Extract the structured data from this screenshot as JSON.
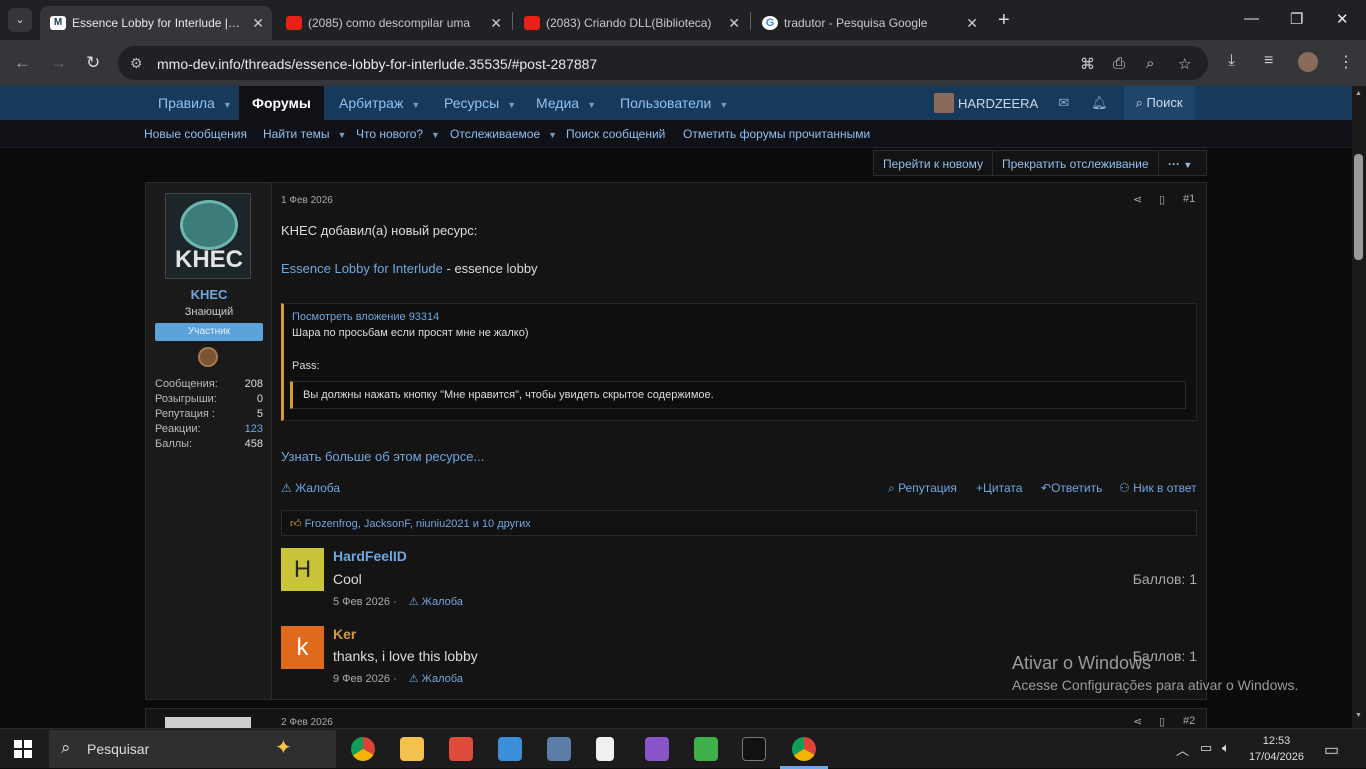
{
  "browser": {
    "tabs": [
      {
        "title": "Essence Lobby for Interlude | Ar",
        "icon": "mmo-dev-icon",
        "active": true
      },
      {
        "title": "(2085) como descompilar uma",
        "icon": "youtube-icon"
      },
      {
        "title": "(2083) Criando DLL(Biblioteca)",
        "icon": "youtube-icon"
      },
      {
        "title": "tradutor - Pesquisa Google",
        "icon": "google-icon"
      }
    ],
    "url": "mmo-dev.info/threads/essence-lobby-for-interlude.35535/#post-287887"
  },
  "forum_nav": {
    "items": [
      "Правила",
      "Форумы",
      "Арбитраж",
      "Ресурсы",
      "Медиа",
      "Пользователи"
    ],
    "active": "Форумы",
    "username": "HARDZEERA",
    "search": "Поиск"
  },
  "sub_nav": [
    "Новые сообщения",
    "Найти темы",
    "Что нового?",
    "Отслеживаемое",
    "Поиск сообщений",
    "Отметить форумы прочитанными"
  ],
  "thread_buttons": {
    "goto_new": "Перейти к новому",
    "unwatch": "Прекратить отслеживание",
    "more": "···"
  },
  "post": {
    "author": {
      "name": "KHEC",
      "avatar_text": "KHEC",
      "title": "Знающий",
      "badge": "Участник",
      "stats": [
        {
          "label": "Сообщения:",
          "value": "208"
        },
        {
          "label": "Розыгрыши:",
          "value": "0"
        },
        {
          "label": "Репутация :",
          "value": "5"
        },
        {
          "label": "Реакции:",
          "value": "123"
        },
        {
          "label": "Баллы:",
          "value": "458"
        }
      ]
    },
    "date": "1 Фев 2026",
    "number": "#1",
    "intro": "KHEC добавил(а) новый ресурс:",
    "resource_link": "Essence Lobby for Interlude",
    "resource_desc": " - essence lobby",
    "quote": {
      "attachment": "Посмотреть вложение 93314",
      "line1": "Шара по просьбам если просят мне не жалко)",
      "pass": "Pass:",
      "hidden": "Вы должны нажать кнопку \"Мне нравится\", чтобы увидеть скрытое содержимое."
    },
    "more_link": "Узнать больше об этом ресурсе...",
    "report": "Жалоба",
    "actions": {
      "reputation": "Репутация",
      "quote": "Цитата",
      "reply": "Ответить",
      "nick": "Ник в ответ"
    },
    "likes": "Frozenfrog, JacksonF, niuniu2021 и 10 других",
    "comments": [
      {
        "initial": "H",
        "name": "HardFeelID",
        "text": "Cool",
        "date": "5 Фев 2026 ·",
        "report": "Жалоба",
        "score": "Баллов: 1",
        "color": "#c9c43a",
        "name_color": "#6fa7e0"
      },
      {
        "initial": "k",
        "name": "Ker",
        "text": "thanks, i love this lobby",
        "date": "9 Фев 2026 ·",
        "report": "Жалоба",
        "score": "Баллов: 1",
        "color": "#e06a1c",
        "name_color": "#d49a3a"
      }
    ]
  },
  "post2": {
    "date": "2 Фев 2026",
    "number": "#2"
  },
  "watermark": {
    "line1": "Ativar o Windows",
    "line2": "Acesse Configurações para ativar o Windows."
  },
  "taskbar": {
    "search": "Pesquisar",
    "time": "12:53",
    "date": "17/04/2026"
  }
}
